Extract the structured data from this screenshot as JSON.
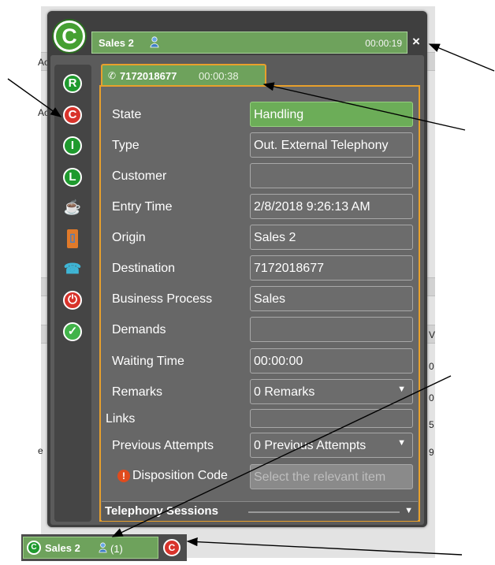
{
  "background": {
    "snippets": [
      "Ac",
      "Ac",
      "e",
      "0",
      "0",
      "5",
      "9",
      "V"
    ]
  },
  "session": {
    "badge": "C",
    "title": "Sales 2",
    "timer": "00:00:19",
    "close_label": "×"
  },
  "sidebar": {
    "items": [
      {
        "icon": "R",
        "name": "ready-icon"
      },
      {
        "icon": "C",
        "name": "contact-icon"
      },
      {
        "icon": "I",
        "name": "idle-icon"
      },
      {
        "icon": "L",
        "name": "logoff-icon"
      },
      {
        "icon": "☕",
        "name": "break-cup-icon"
      },
      {
        "icon": "▯",
        "name": "door-exit-icon"
      },
      {
        "icon": "☎",
        "name": "phone-transfer-icon"
      },
      {
        "icon": "⏻",
        "name": "power-icon"
      },
      {
        "icon": "✓",
        "name": "complete-check-icon"
      }
    ]
  },
  "call_tab": {
    "number": "7172018677",
    "duration": "00:00:38"
  },
  "details": {
    "state": {
      "label": "State",
      "value": "Handling"
    },
    "type": {
      "label": "Type",
      "value": "Out. External Telephony"
    },
    "customer": {
      "label": "Customer",
      "value": ""
    },
    "entry_time": {
      "label": "Entry Time",
      "value": "2/8/2018 9:26:13 AM"
    },
    "origin": {
      "label": "Origin",
      "value": "Sales 2"
    },
    "destination": {
      "label": "Destination",
      "value": "7172018677"
    },
    "business_process": {
      "label": "Business Process",
      "value": "Sales"
    },
    "demands": {
      "label": "Demands",
      "value": ""
    },
    "waiting_time": {
      "label": "Waiting Time",
      "value": "00:00:00"
    },
    "remarks": {
      "label": "Remarks",
      "value": "0 Remarks"
    },
    "links": {
      "label": "Links",
      "value": ""
    },
    "previous_attempts": {
      "label": "Previous Attempts",
      "value": "0 Previous Attempts"
    },
    "disposition_code": {
      "label": "Disposition Code",
      "placeholder": "Select the relevant item"
    }
  },
  "section": {
    "title": "Telephony Sessions"
  },
  "taskbar": {
    "badge": "C",
    "label": "Sales 2",
    "count": "(1)",
    "alert_badge": "C"
  },
  "colors": {
    "accent_green": "#6ea25c",
    "border_orange": "#e8a02c",
    "panel_dark": "#3f3f3f"
  }
}
